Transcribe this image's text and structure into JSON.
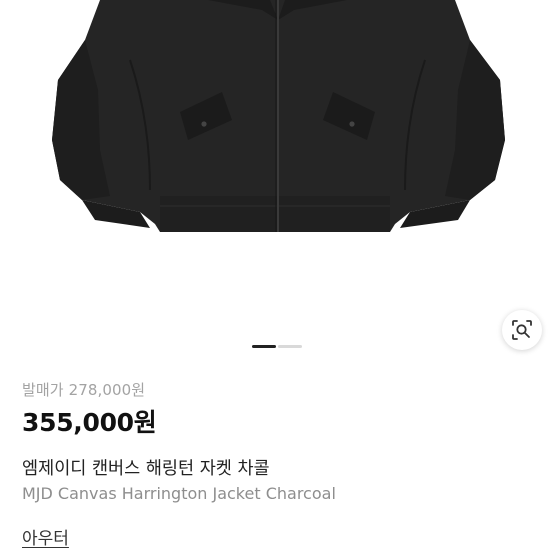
{
  "product": {
    "release_price_label": "발매가",
    "release_price": "278,000원",
    "price": "355,000원",
    "name_ko": "엠제이디 캔버스 해링턴 자켓 차콜",
    "name_en": "MJD Canvas Harrington Jacket Charcoal",
    "category": "아우터"
  },
  "gallery": {
    "image_count": 2,
    "current_index": 1,
    "search_icon": "lens-search-icon"
  },
  "colors": {
    "jacket": "#252525",
    "background": "#ffffff",
    "indicator_active": "#222222",
    "indicator_inactive": "#d9d9d9"
  }
}
